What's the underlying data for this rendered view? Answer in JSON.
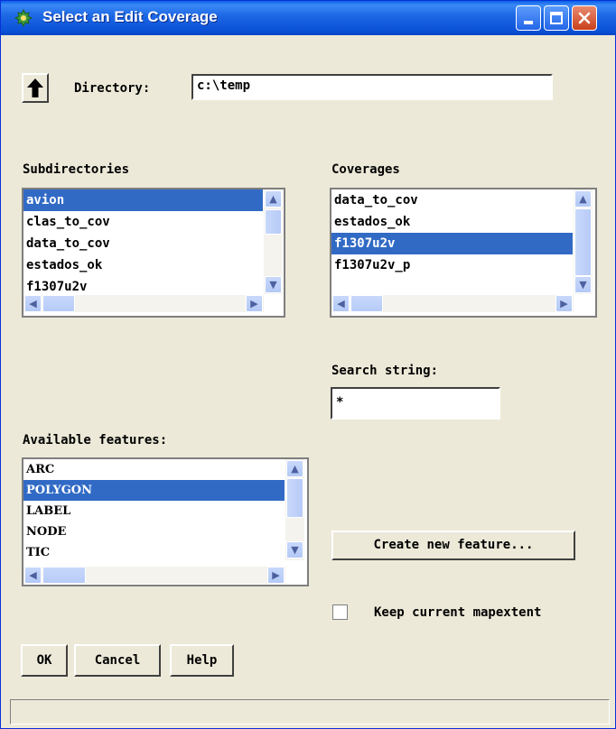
{
  "window": {
    "title": "Select an Edit Coverage"
  },
  "directory": {
    "label": "Directory:",
    "value": "c:\\temp"
  },
  "subdirectories": {
    "label": "Subdirectories",
    "items": [
      "avion",
      "clas_to_cov",
      "data_to_cov",
      "estados_ok",
      "f1307u2v"
    ],
    "selected": "avion"
  },
  "coverages": {
    "label": "Coverages",
    "items": [
      "data_to_cov",
      "estados_ok",
      "f1307u2v",
      "f1307u2v_p"
    ],
    "selected": "f1307u2v"
  },
  "search": {
    "label": "Search string:",
    "value": "*"
  },
  "features": {
    "label": "Available features:",
    "items": [
      "ARC",
      "POLYGON",
      "LABEL",
      "NODE",
      "TIC"
    ],
    "selected": "POLYGON"
  },
  "create_feature_label": "Create new feature...",
  "keep_extent_label": "Keep current mapextent",
  "buttons": {
    "ok": "OK",
    "cancel": "Cancel",
    "help": "Help"
  },
  "colors": {
    "selection": "#316ac5",
    "titlebar": "#0a52d8",
    "dialog_bg": "#ece9d8"
  },
  "icons": {
    "up": "up-arrow-icon",
    "app": "app-icon"
  }
}
